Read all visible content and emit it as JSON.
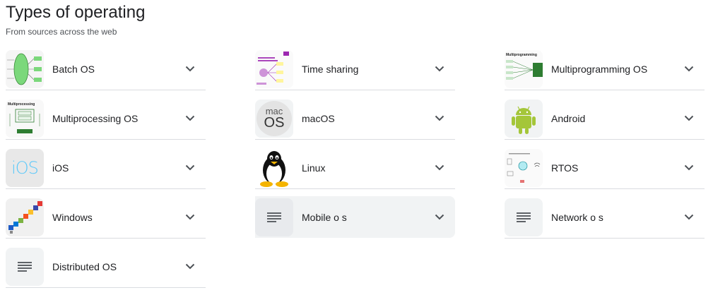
{
  "header": {
    "title": "Types of operating",
    "subtitle": "From sources across the web"
  },
  "items": [
    {
      "label": "Batch OS",
      "icon": "batch-os-diagram-thumbnail"
    },
    {
      "label": "Multiprocessing OS",
      "icon": "multiprocessing-diagram-thumbnail",
      "thumb_text": "Multiprocessing"
    },
    {
      "label": "iOS",
      "icon": "ios-logo-thumbnail",
      "thumb_text": "iOS"
    },
    {
      "label": "Windows",
      "icon": "windows-versions-thumbnail"
    },
    {
      "label": "Distributed OS",
      "icon": "document-lines-icon"
    },
    {
      "label": "Time sharing",
      "icon": "time-sharing-diagram-thumbnail"
    },
    {
      "label": "macOS",
      "icon": "macos-logo-thumbnail",
      "thumb_text_top": "mac",
      "thumb_text_bottom": "OS"
    },
    {
      "label": "Linux",
      "icon": "tux-penguin-thumbnail"
    },
    {
      "label": "Mobile o s",
      "icon": "document-lines-icon"
    },
    {
      "label": "Multiprogramming OS",
      "icon": "multiprogramming-diagram-thumbnail",
      "thumb_text": "Multiprogramming"
    },
    {
      "label": "Android",
      "icon": "android-robot-thumbnail"
    },
    {
      "label": "RTOS",
      "icon": "rtos-diagram-thumbnail"
    },
    {
      "label": "Network o s",
      "icon": "document-lines-icon"
    }
  ],
  "colors": {
    "android_green": "#a4c639",
    "diagram_green": "#2e7d32",
    "ios_blue": "#5ac8fa"
  }
}
